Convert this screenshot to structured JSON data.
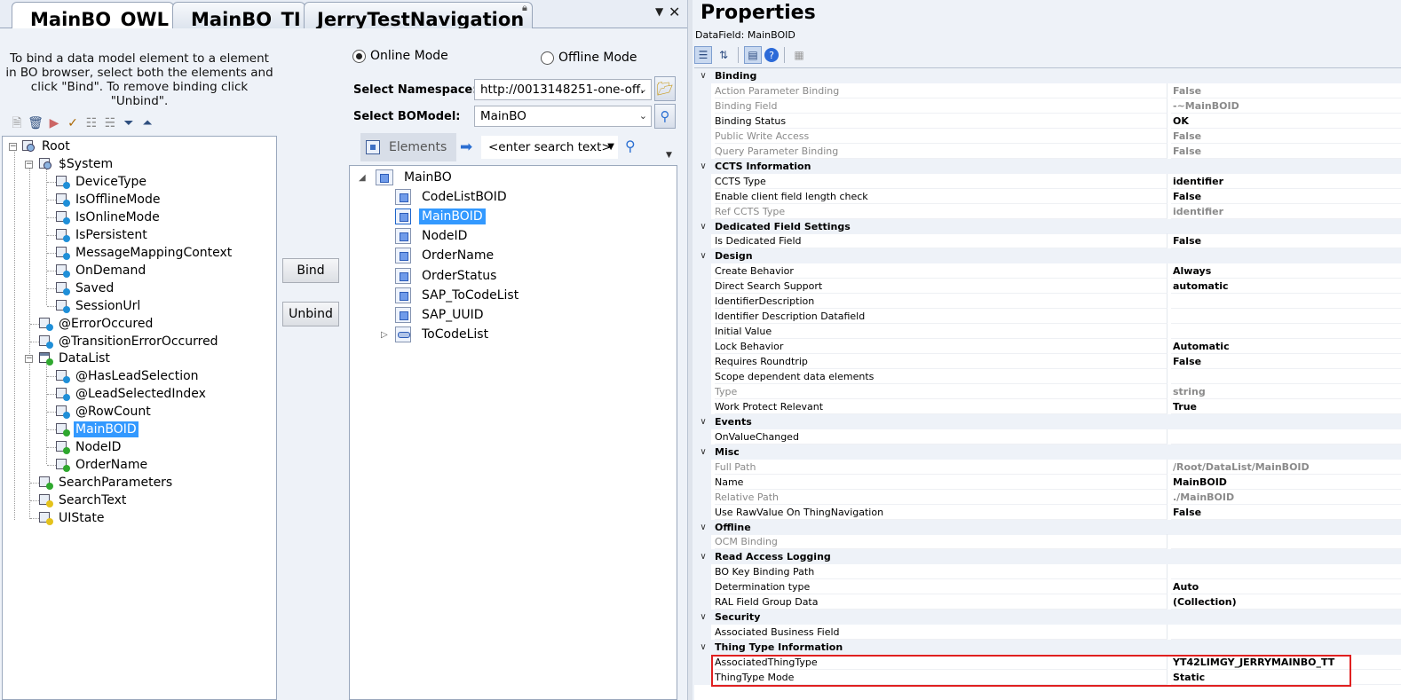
{
  "tabs": [
    {
      "label": "MainBO_OWL",
      "active": true
    },
    {
      "label": "MainBO_TI",
      "active": false
    },
    {
      "label": "JerryTestNavigation",
      "active": false
    }
  ],
  "binding": {
    "help_text": "To bind a data model element to a element in BO browser, select both the elements and click \"Bind\". To remove binding click \"Unbind\".",
    "bind_label": "Bind",
    "unbind_label": "Unbind"
  },
  "tree_toolbar_icons": [
    "new-icon",
    "delete-icon",
    "bind-tree-icon",
    "bind-check-icon",
    "network-icon",
    "hierarchy-icon",
    "collapse-all-icon",
    "expand-all-icon"
  ],
  "data_model_tree": [
    {
      "label": "Root",
      "level": 0,
      "icon": "root",
      "expanded": true
    },
    {
      "label": "$System",
      "level": 1,
      "icon": "structure",
      "expanded": true
    },
    {
      "label": "DeviceType",
      "level": 2,
      "dot": "blue"
    },
    {
      "label": "IsOfflineMode",
      "level": 2,
      "dot": "blue"
    },
    {
      "label": "IsOnlineMode",
      "level": 2,
      "dot": "blue"
    },
    {
      "label": "IsPersistent",
      "level": 2,
      "dot": "blue"
    },
    {
      "label": "MessageMappingContext",
      "level": 2,
      "dot": "blue"
    },
    {
      "label": "OnDemand",
      "level": 2,
      "dot": "blue"
    },
    {
      "label": "Saved",
      "level": 2,
      "dot": "blue"
    },
    {
      "label": "SessionUrl",
      "level": 2,
      "dot": "blue"
    },
    {
      "label": "@ErrorOccured",
      "level": 1,
      "dot": "blue"
    },
    {
      "label": "@TransitionErrorOccurred",
      "level": 1,
      "dot": "blue"
    },
    {
      "label": "DataList",
      "level": 1,
      "icon": "list",
      "expanded": true
    },
    {
      "label": "@HasLeadSelection",
      "level": 2,
      "dot": "blue"
    },
    {
      "label": "@LeadSelectedIndex",
      "level": 2,
      "dot": "blue"
    },
    {
      "label": "@RowCount",
      "level": 2,
      "dot": "blue"
    },
    {
      "label": "MainBOID",
      "level": 2,
      "dot": "green",
      "selected": true
    },
    {
      "label": "NodeID",
      "level": 2,
      "dot": "green"
    },
    {
      "label": "OrderName",
      "level": 2,
      "dot": "green"
    },
    {
      "label": "SearchParameters",
      "level": 1,
      "icon": "structure"
    },
    {
      "label": "SearchText",
      "level": 1,
      "dot": "yellow"
    },
    {
      "label": "UIState",
      "level": 1,
      "icon": "structure-yellow"
    }
  ],
  "bo_browser": {
    "online_mode_label": "Online Mode",
    "offline_mode_label": "Offline Mode",
    "mode": "online",
    "namespace_label": "Select Namespace:",
    "namespace_value": "http://0013148251-one-off.",
    "bomodel_label": "Select BOModel:",
    "bomodel_value": "MainBO",
    "elements_label": "Elements",
    "search_placeholder": "<enter search text>",
    "root": "MainBO",
    "items": [
      {
        "label": "CodeListBOID"
      },
      {
        "label": "MainBOID",
        "selected": true
      },
      {
        "label": "NodeID"
      },
      {
        "label": "OrderName"
      },
      {
        "label": "OrderStatus"
      },
      {
        "label": "SAP_ToCodeList"
      },
      {
        "label": "SAP_UUID"
      },
      {
        "label": "ToCodeList",
        "association": true
      }
    ]
  },
  "properties": {
    "title": "Properties",
    "subtitle": "DataField: MainBOID",
    "toolbar_icons": [
      "categorized-icon",
      "alphabetical-icon",
      "properties-icon",
      "help-icon",
      "property-pages-icon"
    ],
    "categories": [
      {
        "name": "Binding",
        "rows": [
          {
            "name": "Action Parameter Binding",
            "value": "False",
            "readonly": true
          },
          {
            "name": "Binding Field",
            "value": "-~MainBOID",
            "readonly": true
          },
          {
            "name": "Binding Status",
            "value": "OK"
          },
          {
            "name": "Public Write Access",
            "value": "False",
            "readonly": true
          },
          {
            "name": "Query Parameter Binding",
            "value": "False",
            "readonly": true
          }
        ]
      },
      {
        "name": "CCTS Information",
        "rows": [
          {
            "name": "CCTS Type",
            "value": "identifier"
          },
          {
            "name": "Enable client field length check",
            "value": "False"
          },
          {
            "name": "Ref CCTS Type",
            "value": "identifier",
            "readonly": true
          }
        ]
      },
      {
        "name": "Dedicated Field Settings",
        "rows": [
          {
            "name": "Is Dedicated Field",
            "value": "False"
          }
        ]
      },
      {
        "name": "Design",
        "rows": [
          {
            "name": "Create Behavior",
            "value": "Always"
          },
          {
            "name": "Direct Search Support",
            "value": "automatic"
          },
          {
            "name": "IdentifierDescription",
            "value": ""
          },
          {
            "name": "Identifier Description Datafield",
            "value": ""
          },
          {
            "name": "Initial Value",
            "value": ""
          },
          {
            "name": "Lock Behavior",
            "value": "Automatic"
          },
          {
            "name": "Requires Roundtrip",
            "value": "False"
          },
          {
            "name": "Scope dependent data elements",
            "value": ""
          },
          {
            "name": "Type",
            "value": "string",
            "readonly": true
          },
          {
            "name": "Work Protect Relevant",
            "value": "True"
          }
        ]
      },
      {
        "name": "Events",
        "rows": [
          {
            "name": "OnValueChanged",
            "value": ""
          }
        ]
      },
      {
        "name": "Misc",
        "rows": [
          {
            "name": "Full Path",
            "value": "/Root/DataList/MainBOID",
            "readonly": true
          },
          {
            "name": "Name",
            "value": "MainBOID"
          },
          {
            "name": "Relative Path",
            "value": "./MainBOID",
            "readonly": true
          },
          {
            "name": "Use RawValue On ThingNavigation",
            "value": "False"
          }
        ]
      },
      {
        "name": "Offline",
        "rows": [
          {
            "name": "OCM Binding",
            "value": "",
            "readonly": true
          }
        ]
      },
      {
        "name": "Read Access Logging",
        "rows": [
          {
            "name": "BO Key Binding Path",
            "value": ""
          },
          {
            "name": "Determination type",
            "value": "Auto"
          },
          {
            "name": "RAL Field Group Data",
            "value": "(Collection)"
          }
        ]
      },
      {
        "name": "Security",
        "rows": [
          {
            "name": "Associated Business Field",
            "value": ""
          }
        ]
      },
      {
        "name": "Thing Type Information",
        "rows": [
          {
            "name": "AssociatedThingType",
            "value": "YT42LIMGY_JERRYMAINBO_TT"
          },
          {
            "name": "ThingType Mode",
            "value": "Static"
          }
        ]
      }
    ]
  },
  "colors": {
    "selection": "#3399ff",
    "highlight": "#e02020",
    "panel": "#eef2f8"
  }
}
